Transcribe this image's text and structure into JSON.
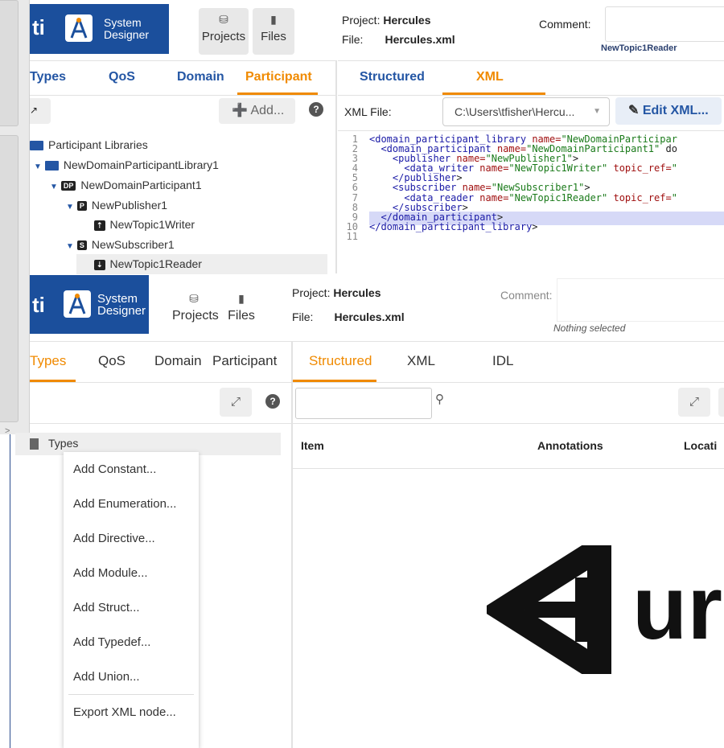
{
  "top": {
    "brand": {
      "rti": "ti",
      "name_line1": "System",
      "name_line2": "Designer"
    },
    "toolbar": {
      "projects": "Projects",
      "files": "Files"
    },
    "project_label": "Project:",
    "project_value": "Hercules",
    "file_label": "File:",
    "file_value": "Hercules.xml",
    "comment_label": "Comment:",
    "selected_note": "NewTopic1Reader",
    "left_tabs": [
      "Types",
      "QoS",
      "Domain",
      "Participant"
    ],
    "right_tabs": [
      "Structured",
      "XML"
    ],
    "add_label": "Add...",
    "xml_file_label": "XML File:",
    "xml_file_value": "C:\\Users\\tfisher\\Hercu...",
    "edit_xml_label": "Edit XML...",
    "tree": [
      "Participant Libraries",
      "NewDomainParticipantLibrary1",
      "NewDomainParticipant1",
      "NewPublisher1",
      "NewTopic1Writer",
      "NewSubscriber1",
      "NewTopic1Reader"
    ],
    "badges": {
      "dp": "DP",
      "p": "P",
      "s": "S"
    },
    "code_lines": [
      {
        "n": "1",
        "t": "<domain_participant_library name=\"NewDomainParticipar"
      },
      {
        "n": "2",
        "t": "  <domain_participant name=\"NewDomainParticipant1\" do"
      },
      {
        "n": "3",
        "t": "    <publisher name=\"NewPublisher1\">"
      },
      {
        "n": "4",
        "t": "      <data_writer name=\"NewTopic1Writer\" topic_ref=\""
      },
      {
        "n": "5",
        "t": "    </publisher>"
      },
      {
        "n": "6",
        "t": "    <subscriber name=\"NewSubscriber1\">"
      },
      {
        "n": "7",
        "t": "      <data_reader name=\"NewTopic1Reader\" topic_ref=\""
      },
      {
        "n": "8",
        "t": "    </subscriber>"
      },
      {
        "n": "9",
        "t": "  </domain_participant>"
      },
      {
        "n": "10",
        "t": "</domain_participant_library>"
      },
      {
        "n": "11",
        "t": ""
      }
    ]
  },
  "bottom": {
    "brand": {
      "rti": "ti",
      "name_line1": "System",
      "name_line2": "Designer"
    },
    "toolbar": {
      "projects": "Projects",
      "files": "Files"
    },
    "project_label": "Project:",
    "project_value": "Hercules",
    "file_label": "File:",
    "file_value": "Hercules.xml",
    "comment_label": "Comment:",
    "selected_note": "Nothing selected",
    "left_tabs": [
      "Types",
      "QoS",
      "Domain",
      "Participant"
    ],
    "right_tabs": [
      "Structured",
      "XML",
      "IDL"
    ],
    "tree_root": "Types",
    "table_headers": [
      "Item",
      "Annotations",
      "Locati"
    ],
    "context_menu": [
      "Add Constant...",
      "Add Enumeration...",
      "Add Directive...",
      "Add Module...",
      "Add Struct...",
      "Add Typedef...",
      "Add Union...",
      "Export XML node..."
    ]
  },
  "unity_logo_text": "ur",
  "colors": {
    "brand": "#1b4f9c",
    "accent": "#f08a00",
    "link": "#2456a4",
    "highlight": "#d6d9f7"
  }
}
